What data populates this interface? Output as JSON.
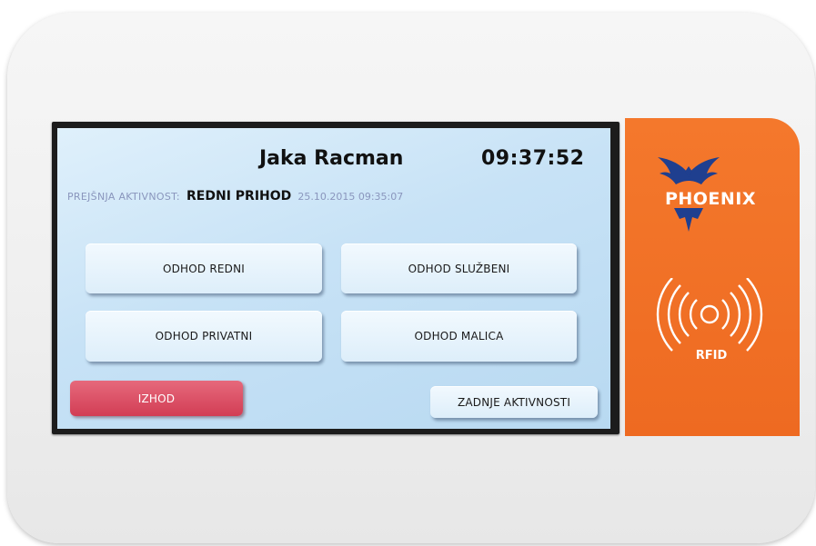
{
  "header": {
    "user_name": "Jaka Racman",
    "clock": "09:37:52"
  },
  "previous_activity": {
    "label": "PREJŠNJA AKTIVNOST:",
    "value": "REDNI PRIHOD",
    "datetime": "25.10.2015 09:35:07"
  },
  "actions": {
    "regular_departure": "ODHOD REDNI",
    "business_departure": "ODHOD SLUŽBENI",
    "private_departure": "ODHOD PRIVATNI",
    "lunch_departure": "ODHOD MALICA",
    "exit": "IZHOD",
    "recent_activities": "ZADNJE AKTIVNOSTI"
  },
  "device": {
    "brand": "PHOENIX",
    "rfid_label": "RFID",
    "icons": [
      "phoenix-logo-icon",
      "rfid-icon"
    ],
    "colors": {
      "panel": "#f07024",
      "exit_button": "#d94459",
      "screen": "#c9e3f6",
      "logo": "#1f3f8f"
    }
  }
}
